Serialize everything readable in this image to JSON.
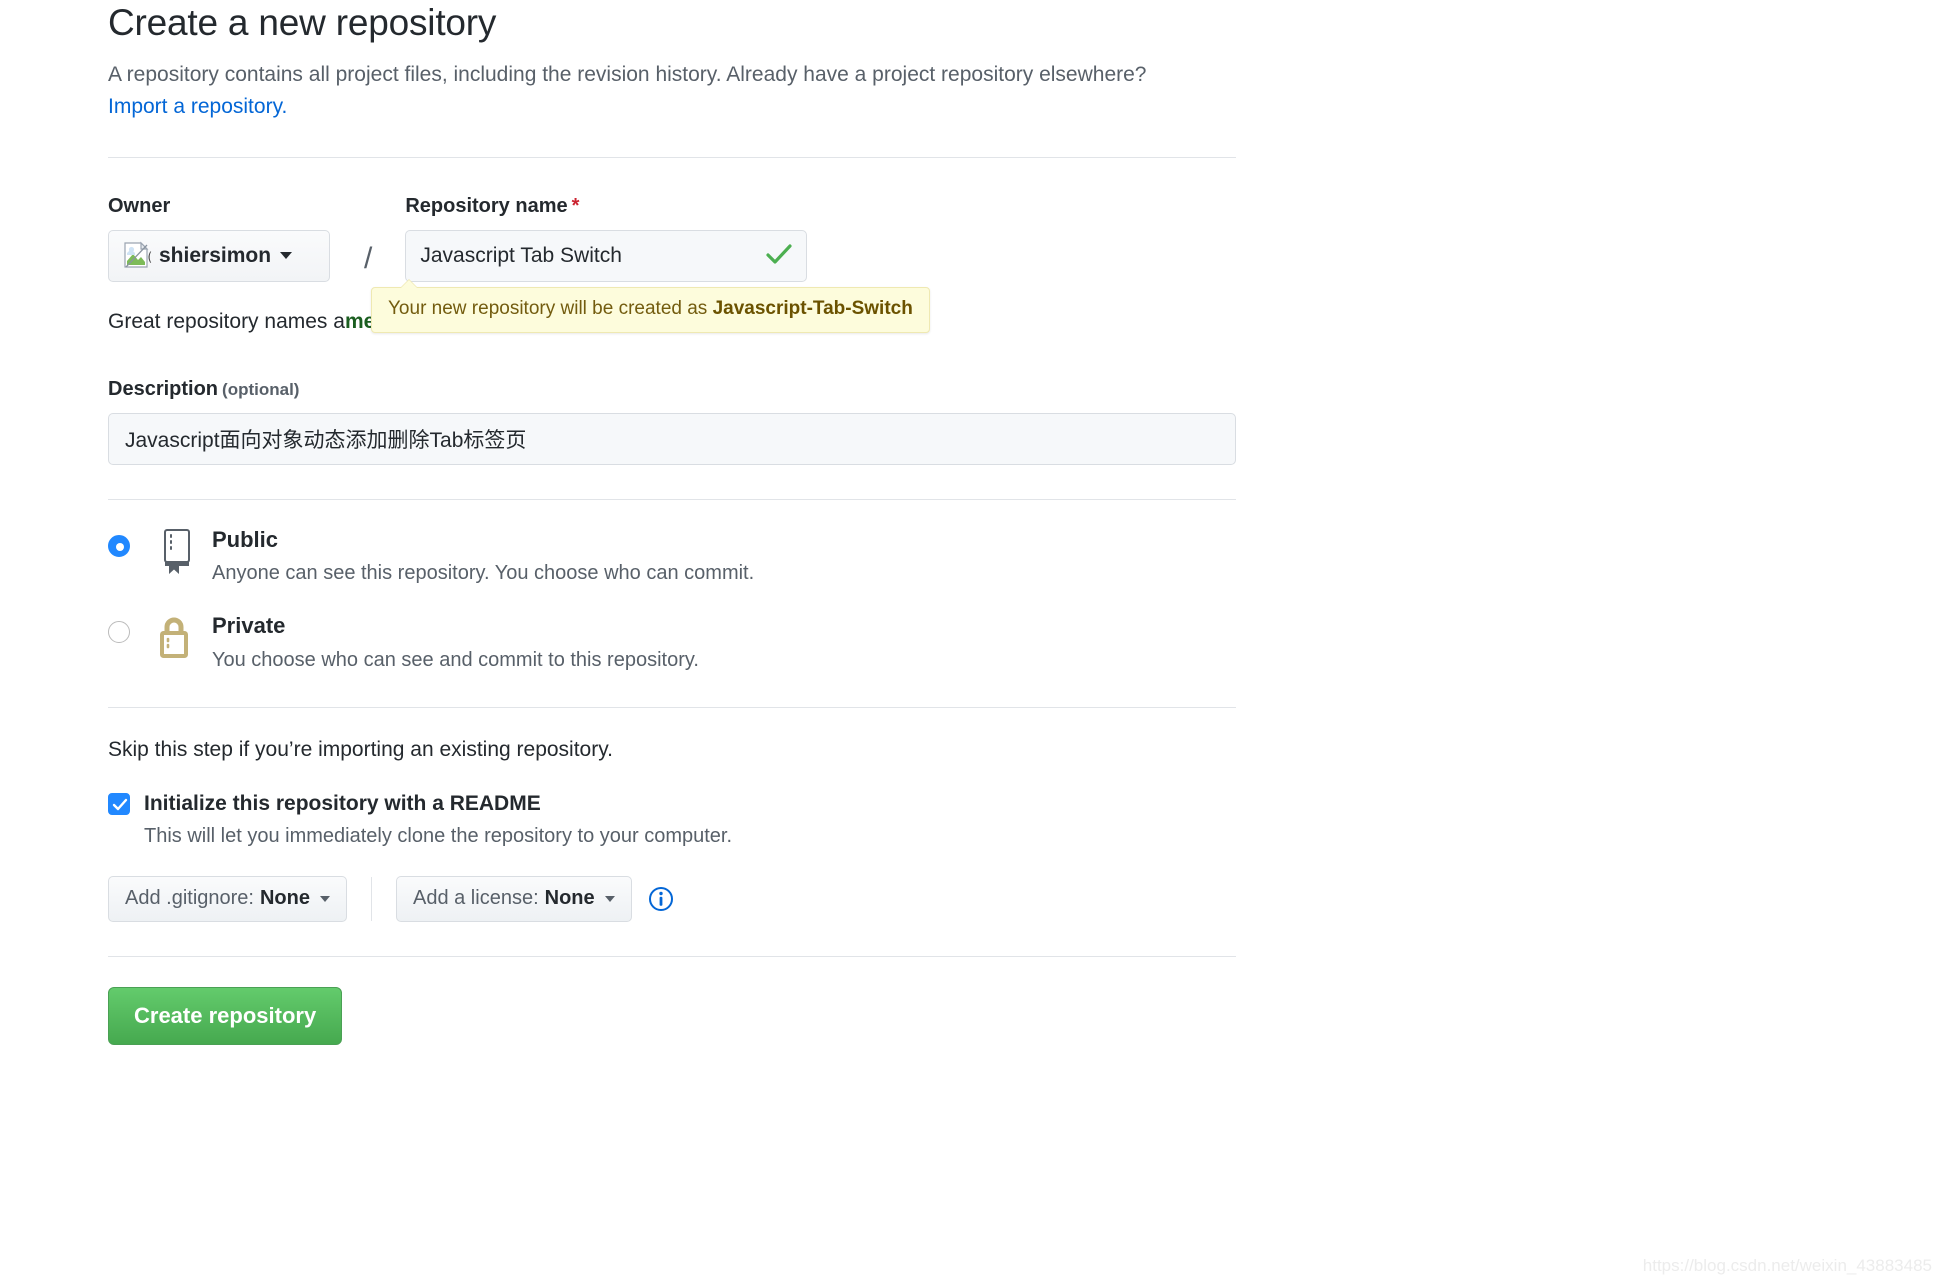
{
  "header": {
    "title": "Create a new repository",
    "subtitle_before": "A repository contains all project files, including the revision history. Already have a project repository elsewhere? ",
    "import_link": "Import a repository."
  },
  "owner": {
    "label": "Owner",
    "name": "shiersimon",
    "avatar_icon": "broken-image-icon",
    "caret_icon": "chevron-down-icon",
    "separator": "/"
  },
  "repo_name": {
    "label": "Repository name",
    "required_marker": "*",
    "value": "Javascript Tab Switch",
    "placeholder": "",
    "valid_icon": "check-icon"
  },
  "tooltip": {
    "prefix": "Your new repository will be created as ",
    "repo_slug": "Javascript-Tab-Switch"
  },
  "helper": {
    "text_before": "Great repository names a",
    "suggestion": "me-waddle",
    "text_after": "?"
  },
  "description": {
    "label": "Description",
    "optional": "(optional)",
    "value": "Javascript面向对象动态添加删除Tab标签页",
    "placeholder": ""
  },
  "visibility": {
    "options": [
      {
        "id": "public",
        "title": "Public",
        "description": "Anyone can see this repository. You choose who can commit.",
        "icon": "repo-book-icon",
        "selected": true
      },
      {
        "id": "private",
        "title": "Private",
        "description": "You choose who can see and commit to this repository.",
        "icon": "lock-icon",
        "selected": false
      }
    ]
  },
  "initialize": {
    "skip_note": "Skip this step if you’re importing an existing repository.",
    "checkbox_label": "Initialize this repository with a README",
    "checkbox_checked": true,
    "sub_note": "This will let you immediately clone the repository to your computer.",
    "gitignore_prefix": "Add .gitignore:",
    "gitignore_value": "None",
    "license_prefix": "Add a license:",
    "license_value": "None",
    "info_icon": "info-icon"
  },
  "submit": {
    "label": "Create repository"
  },
  "watermark": {
    "text": "https://blog.csdn.net/weixin_43883485"
  },
  "colors": {
    "link": "#0366d6",
    "required": "#cb2431",
    "accent_blue": "#2188ff",
    "success_green": "#46a94f",
    "check_green": "#4caf50",
    "tooltip_bg": "#fdfcdc",
    "tooltip_text": "#735c0f",
    "lock_tan": "#c3b178",
    "suggestion_green": "#1b5e20"
  }
}
